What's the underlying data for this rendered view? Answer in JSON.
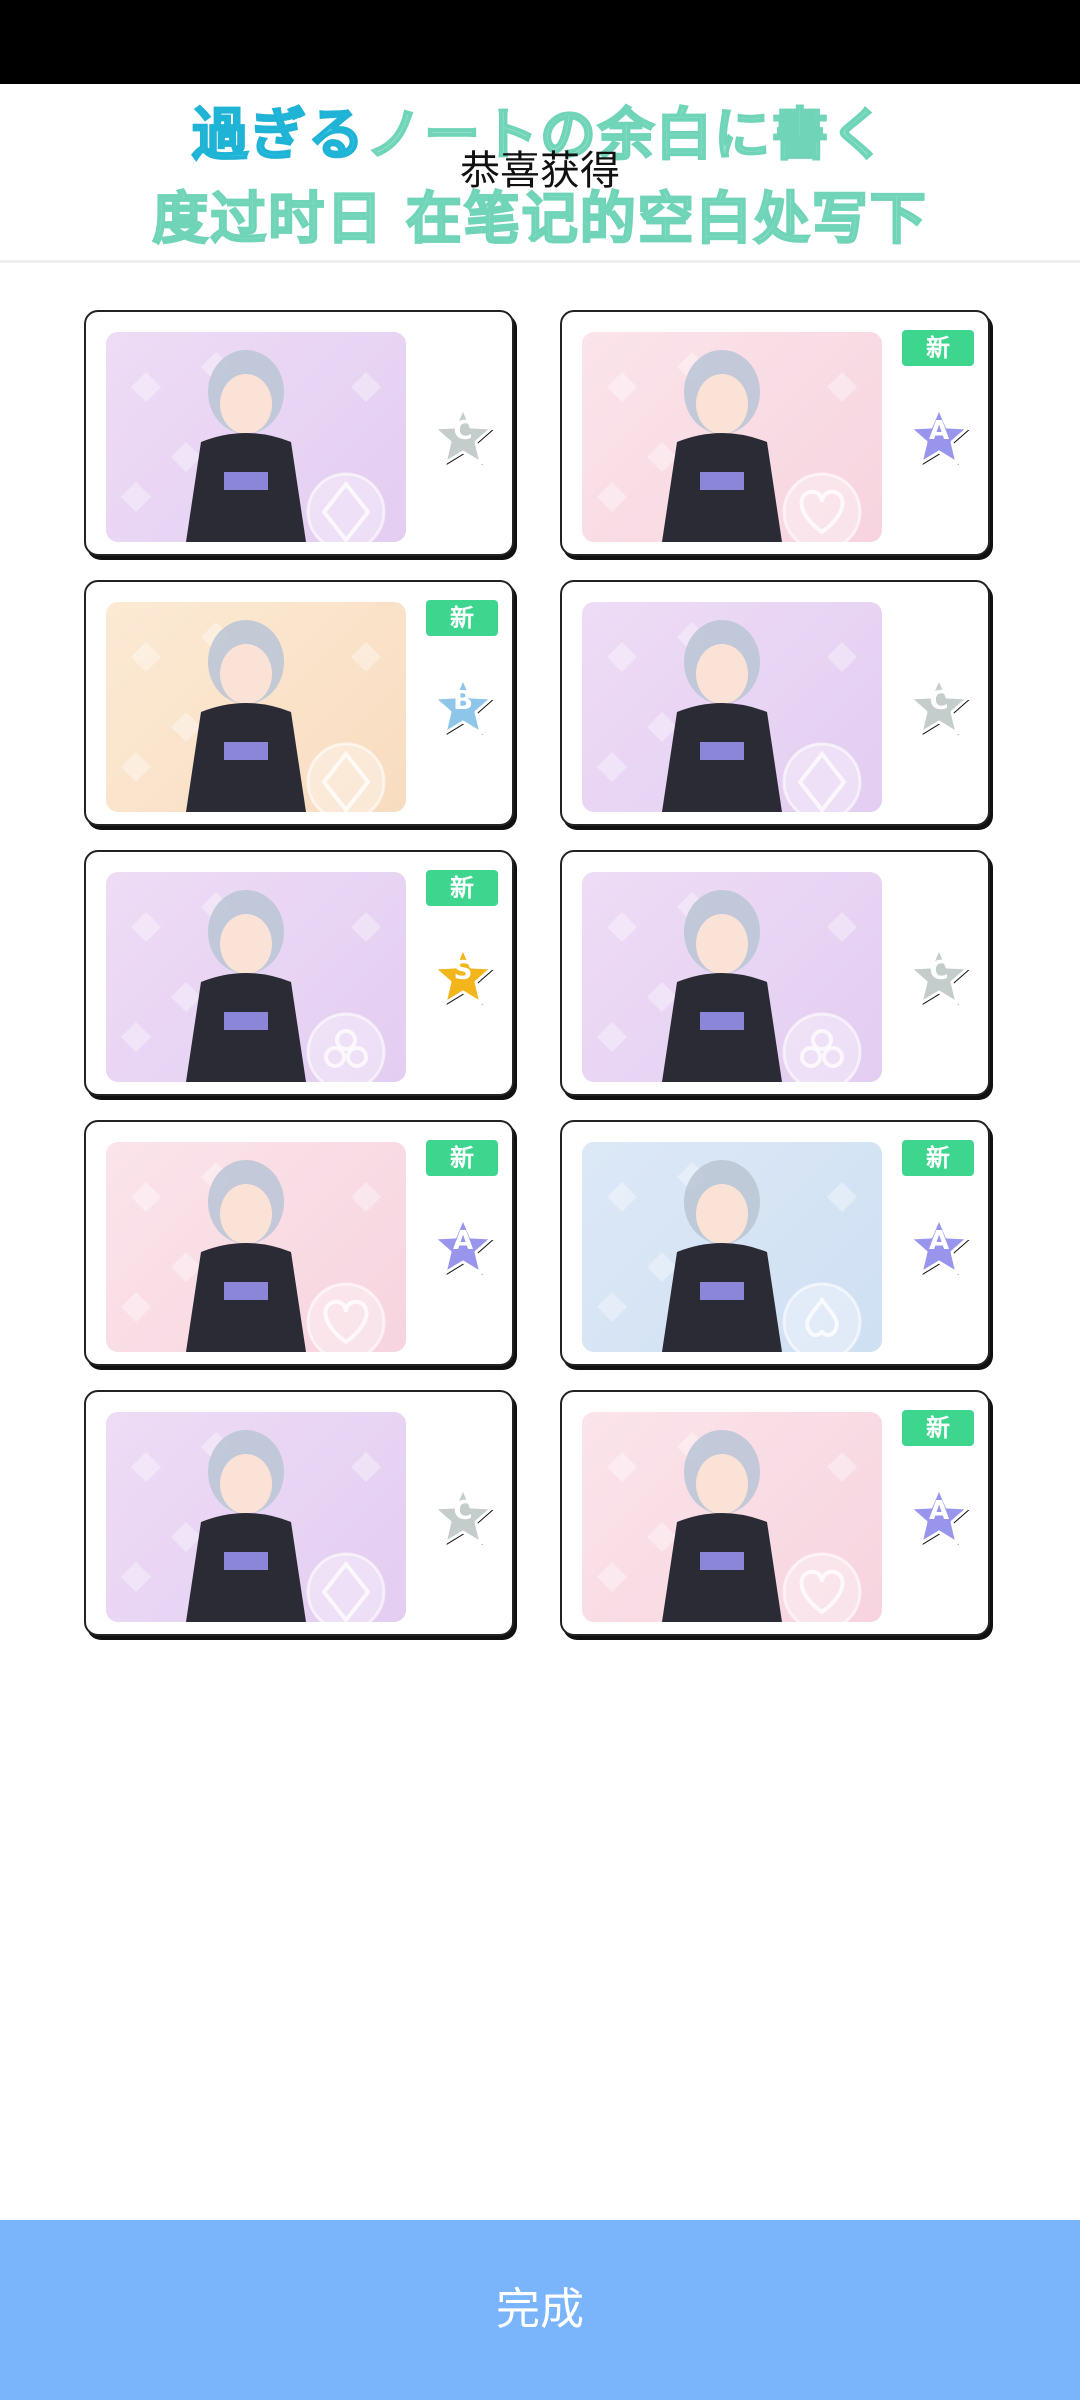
{
  "header": {
    "lyric_line1_sung": "過ぎる",
    "lyric_line1_rest": "ノートの余白に書く",
    "title": "恭喜获得",
    "lyric_line2": "度过时日 在笔记的空白处写下"
  },
  "cards": [
    {
      "rank": "C",
      "is_new": false,
      "badge": "",
      "bg": "purple",
      "emblem": "diamond"
    },
    {
      "rank": "A",
      "is_new": true,
      "badge": "新",
      "bg": "pink",
      "emblem": "heart"
    },
    {
      "rank": "B",
      "is_new": true,
      "badge": "新",
      "bg": "peach",
      "emblem": "diamond"
    },
    {
      "rank": "C",
      "is_new": false,
      "badge": "",
      "bg": "purple",
      "emblem": "diamond"
    },
    {
      "rank": "S",
      "is_new": true,
      "badge": "新",
      "bg": "purple",
      "emblem": "club"
    },
    {
      "rank": "C",
      "is_new": false,
      "badge": "",
      "bg": "purple",
      "emblem": "club"
    },
    {
      "rank": "A",
      "is_new": true,
      "badge": "新",
      "bg": "pink",
      "emblem": "heart"
    },
    {
      "rank": "A",
      "is_new": true,
      "badge": "新",
      "bg": "blue",
      "emblem": "spade"
    },
    {
      "rank": "C",
      "is_new": false,
      "badge": "",
      "bg": "purple",
      "emblem": "diamond"
    },
    {
      "rank": "A",
      "is_new": true,
      "badge": "新",
      "bg": "pink",
      "emblem": "heart"
    }
  ],
  "rank_colors": {
    "C": "#c4cccc",
    "A": "#9a95ec",
    "B": "#8ec6ea",
    "S": "#f3b51c"
  },
  "footer": {
    "done_label": "完成"
  }
}
